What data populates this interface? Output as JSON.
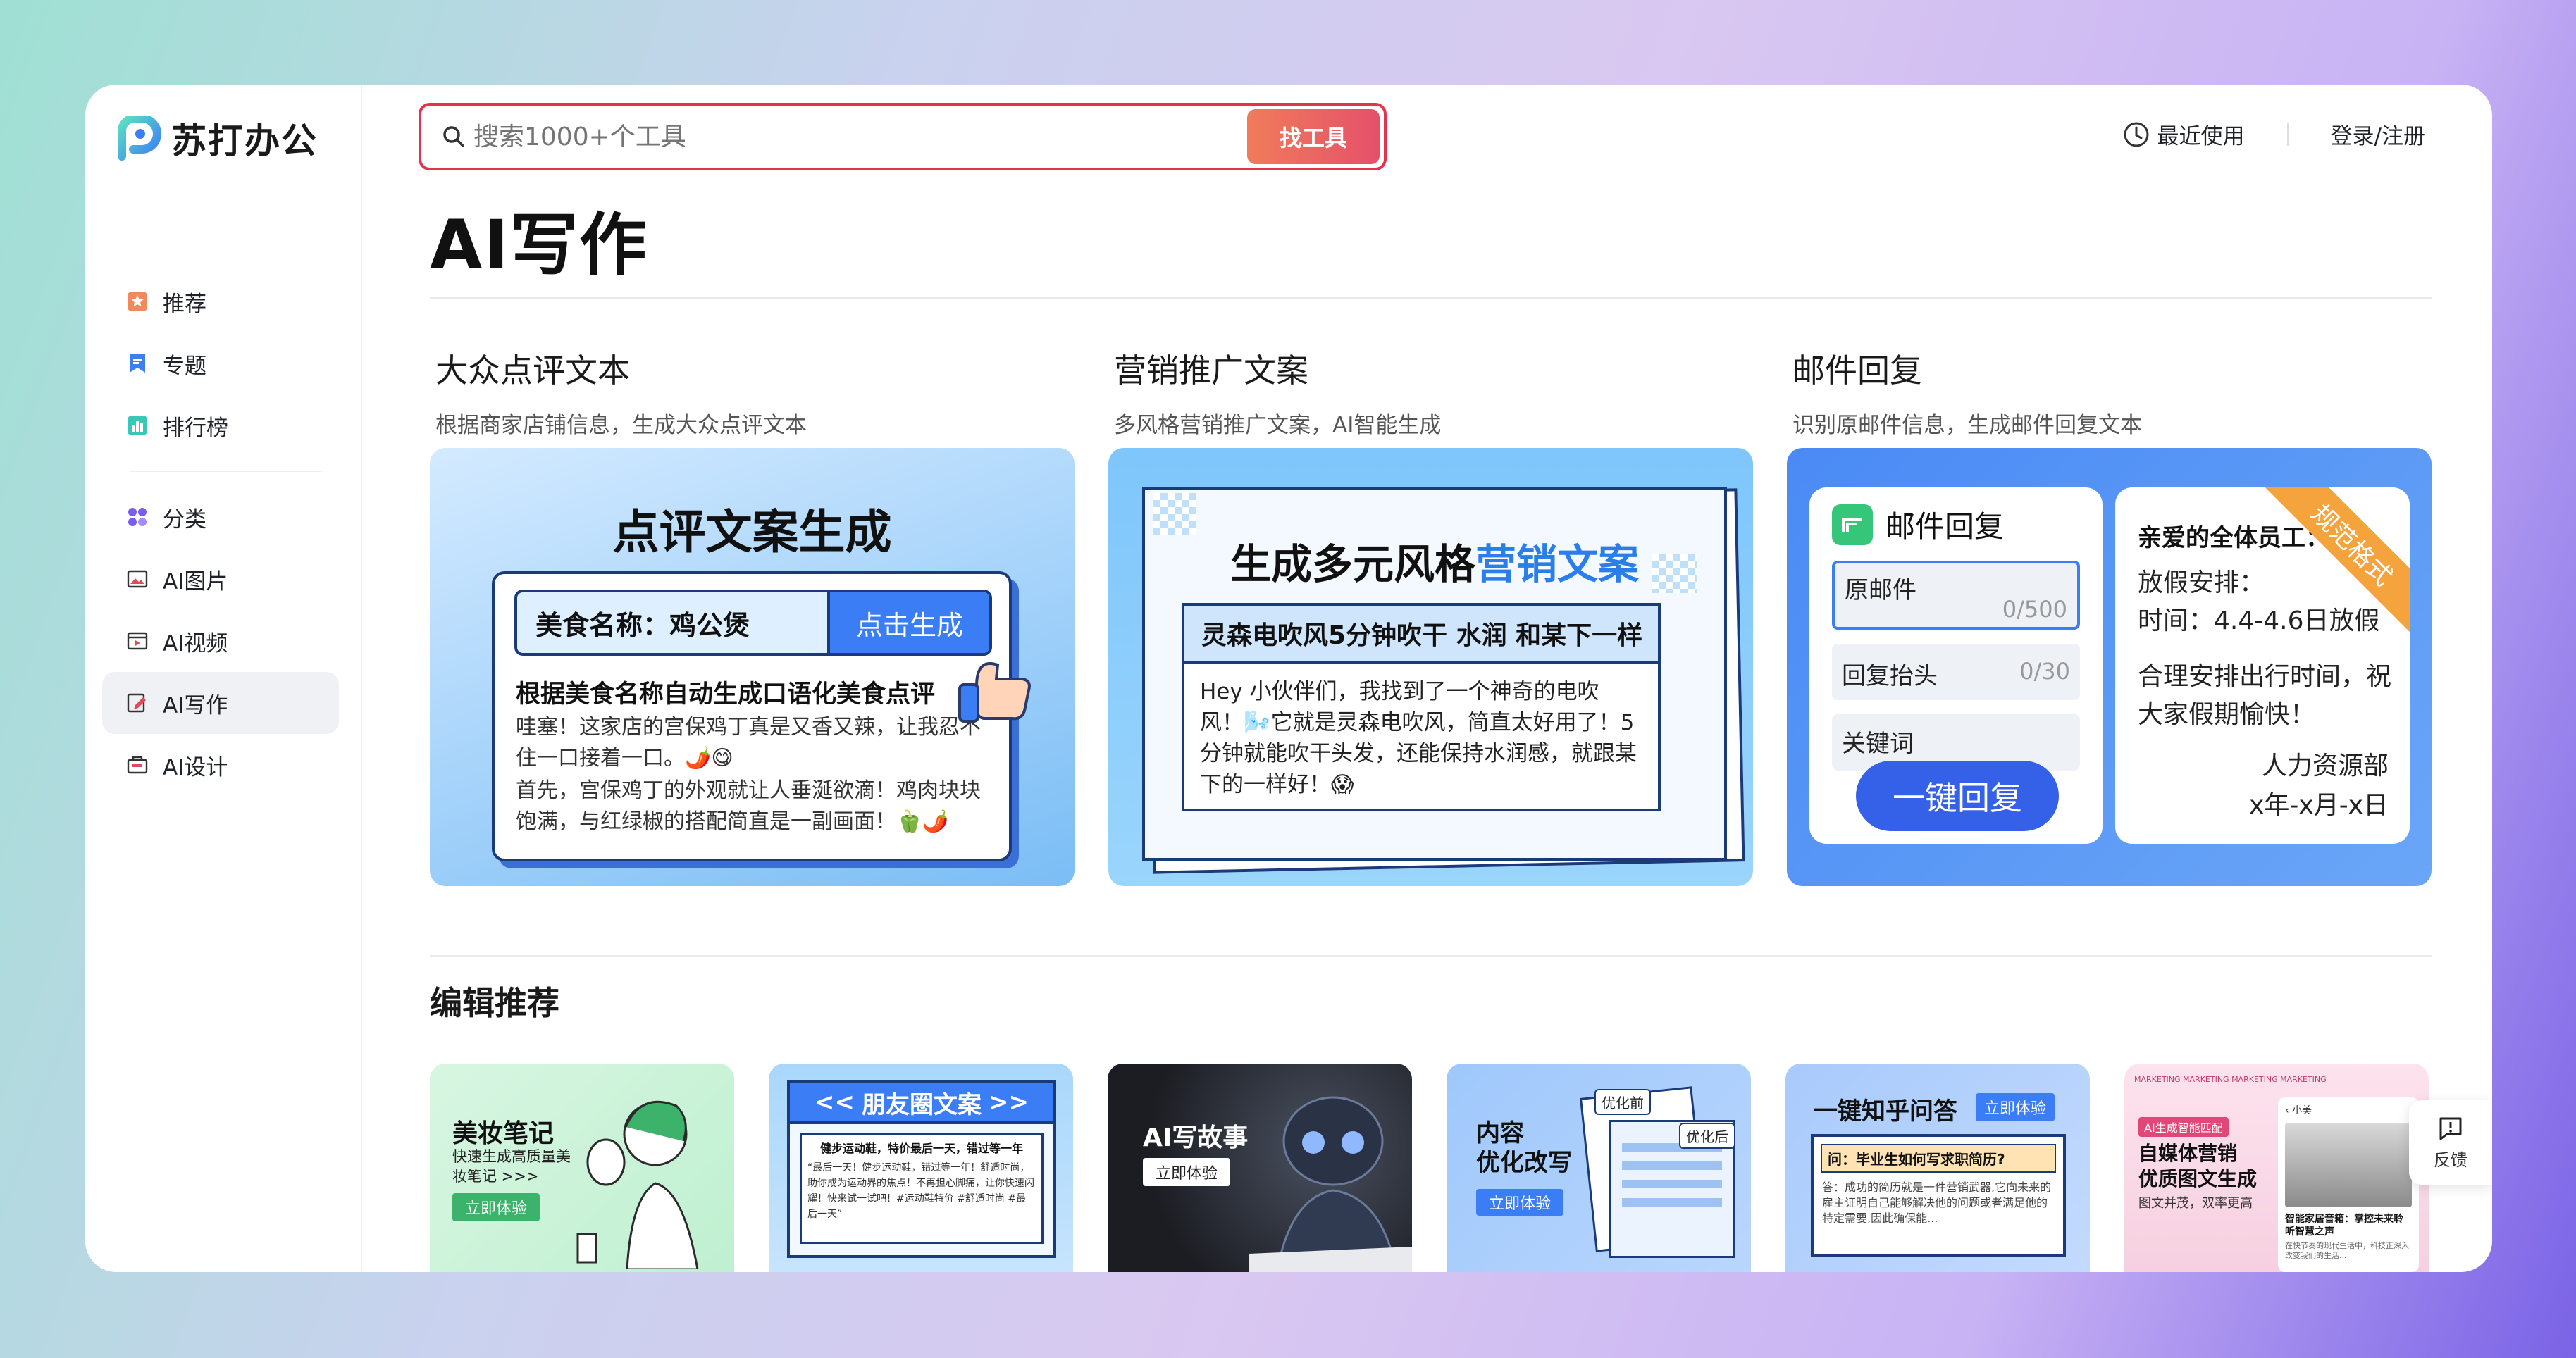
{
  "app": {
    "logo_text": "苏打办公"
  },
  "sidebar": {
    "items": [
      {
        "label": "推荐",
        "icon": "star-icon"
      },
      {
        "label": "专题",
        "icon": "bookmark-icon"
      },
      {
        "label": "排行榜",
        "icon": "bar-chart-icon"
      },
      {
        "label": "分类",
        "icon": "grid-icon"
      },
      {
        "label": "AI图片",
        "icon": "image-icon"
      },
      {
        "label": "AI视频",
        "icon": "video-icon"
      },
      {
        "label": "AI写作",
        "icon": "pen-icon",
        "active": true
      },
      {
        "label": "AI设计",
        "icon": "design-icon"
      }
    ]
  },
  "search": {
    "placeholder": "搜索1000+个工具",
    "button": "找工具"
  },
  "header": {
    "recent": "最近使用",
    "login": "登录/注册"
  },
  "page": {
    "title": "AI写作"
  },
  "cards": [
    {
      "title": "大众点评文本",
      "desc": "根据商家店铺信息，生成大众点评文本",
      "img": {
        "headline": "点评文案生成",
        "field": "美食名称：鸡公煲",
        "button": "点击生成",
        "subtitle": "根据美食名称自动生成口语化美食点评",
        "body1": "哇塞！这家店的宫保鸡丁真是又香又辣，让我忍不住一口接着一口。🌶️😋",
        "body2": "首先，宫保鸡丁的外观就让人垂涎欲滴！鸡肉块块饱满，与红绿椒的搭配简直是一副画面！🫑🌶️"
      }
    },
    {
      "title": "营销推广文案",
      "desc": "多风格营销推广文案，AI智能生成",
      "img": {
        "headline_a": "生成多元风格",
        "headline_b": "营销文案",
        "bar": "灵森电吹风5分钟吹干 水润 和某下一样",
        "body": "Hey 小伙伴们，我找到了一个神奇的电吹风！🌬️它就是灵森电吹风，简直太好用了！5分钟就能吹干头发，还能保持水润感，就跟某下的一样好！😱"
      }
    },
    {
      "title": "邮件回复",
      "desc": "识别原邮件信息，生成邮件回复文本",
      "img": {
        "panel_title": "邮件回复",
        "f1_label": "原邮件",
        "f1_count": "0/500",
        "f2_label": "回复抬头",
        "f2_count": "0/30",
        "f3_label": "关键词",
        "button": "一键回复",
        "ribbon": "规范格式",
        "greeting": "亲爱的全体员工：",
        "line1": "放假安排：",
        "line2": "时间：4.4-4.6日放假",
        "line3": "合理安排出行时间，祝大家假期愉快！",
        "sign1": "人力资源部",
        "sign2": "x年-x月-x日"
      }
    }
  ],
  "editor_section": {
    "title": "编辑推荐"
  },
  "tiles": [
    {
      "title": "美妆笔记",
      "sub": "快速生成高质量美妆笔记 >>>",
      "cta": "立即体验"
    },
    {
      "title": "朋友圈文案",
      "box_title": "健步运动鞋，特价最后一天，错过等一年",
      "box_body": "“最后一天！健步运动鞋，错过等一年！舒适时尚，助你成为运动界的焦点！不再担心脚痛，让你快速闪耀！快来试一试吧！#运动鞋特价 #舒适时尚 #最后一天”"
    },
    {
      "title": "AI写故事",
      "cta": "立即体验"
    },
    {
      "title": "内容\n优化改写",
      "cta": "立即体验",
      "before": "优化前",
      "after": "优化后"
    },
    {
      "title": "一键知乎问答",
      "cta": "立即体验",
      "q": "问：毕业生如何写求职简历?",
      "a": "答：成功的简历就是一件营销武器,它向未来的雇主证明自己能够解决他的问题或者满足他的特定需要,因此确保能..."
    },
    {
      "top": "MARKETING MARKETING MARKETING MARKETING",
      "badge": "AI生成智能匹配",
      "title": "自媒体营销\n优质图文生成",
      "sub": "图文并茂，双率更高",
      "user": "小美",
      "caption": "智能家居音箱：掌控未来聆听智慧之声",
      "caption2": "在快节奏的现代生活中，科技正深入改变我们的生活..."
    }
  ],
  "feedback": {
    "label": "反馈"
  }
}
